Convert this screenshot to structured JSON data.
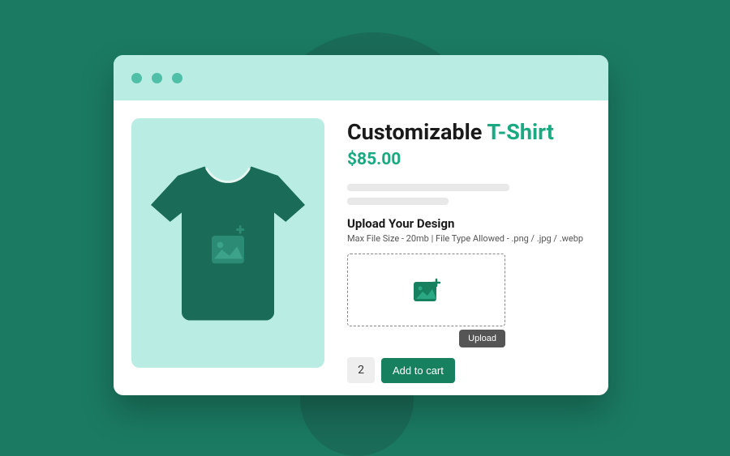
{
  "product": {
    "title_part1": "Customizable ",
    "title_part2": "T-Shirt",
    "price": "$85.00"
  },
  "upload": {
    "heading": "Upload Your Design",
    "hint": "Max File Size - 20mb | File Type Allowed - .png / .jpg / .webp",
    "button_label": "Upload"
  },
  "cart": {
    "quantity": "2",
    "add_label": "Add to cart"
  }
}
